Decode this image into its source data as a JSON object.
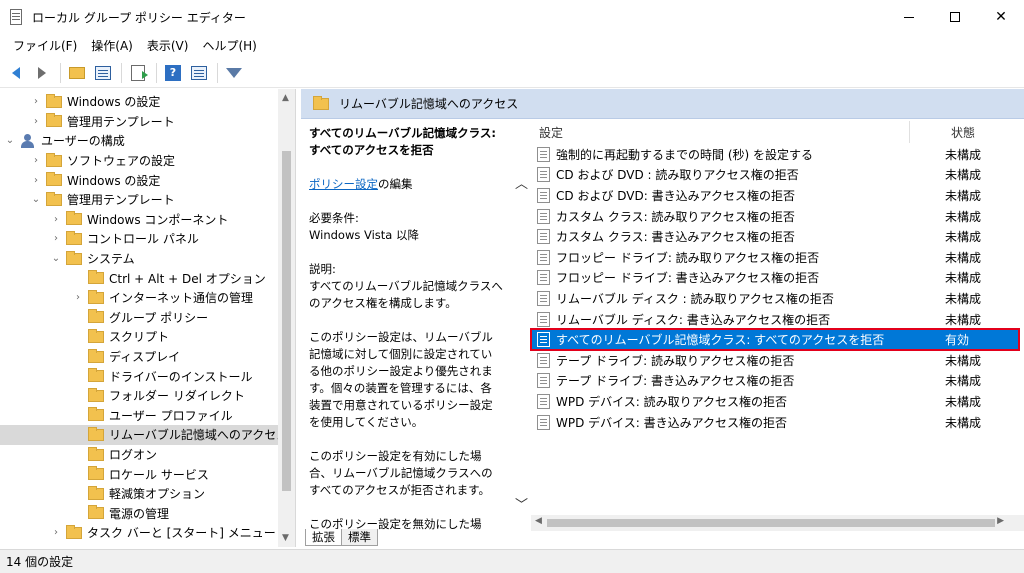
{
  "window": {
    "title": "ローカル グループ ポリシー エディター",
    "minimize_glyph": "",
    "maximize_glyph": "",
    "close_glyph": "✕"
  },
  "menu": [
    {
      "label": "ファイル(F)"
    },
    {
      "label": "操作(A)"
    },
    {
      "label": "表示(V)"
    },
    {
      "label": "ヘルプ(H)"
    }
  ],
  "toolbar": {
    "icons": [
      "back-icon",
      "forward-icon",
      "up-folder-icon",
      "show-hide-tree-icon",
      "export-list-icon",
      "help-icon",
      "properties-icon",
      "filter-icon"
    ],
    "help_glyph": "?"
  },
  "tree": {
    "items": [
      {
        "label": "Windows の設定",
        "level": 2,
        "expander": "›",
        "icon": "folder"
      },
      {
        "label": "管理用テンプレート",
        "level": 2,
        "expander": "›",
        "icon": "folder"
      },
      {
        "label": "ユーザーの構成",
        "level": 0,
        "expander": "⌄",
        "icon": "user"
      },
      {
        "label": "ソフトウェアの設定",
        "level": 2,
        "expander": "›",
        "icon": "folder"
      },
      {
        "label": "Windows の設定",
        "level": 2,
        "expander": "›",
        "icon": "folder"
      },
      {
        "label": "管理用テンプレート",
        "level": 2,
        "expander": "⌄",
        "icon": "folder"
      },
      {
        "label": "Windows コンポーネント",
        "level": 3,
        "expander": "›",
        "icon": "folder"
      },
      {
        "label": "コントロール パネル",
        "level": 3,
        "expander": "›",
        "icon": "folder"
      },
      {
        "label": "システム",
        "level": 3,
        "expander": "⌄",
        "icon": "folder"
      },
      {
        "label": "Ctrl + Alt + Del オプション",
        "level": 4,
        "expander": "",
        "icon": "folder"
      },
      {
        "label": "インターネット通信の管理",
        "level": 4,
        "expander": "›",
        "icon": "folder"
      },
      {
        "label": "グループ ポリシー",
        "level": 4,
        "expander": "",
        "icon": "folder"
      },
      {
        "label": "スクリプト",
        "level": 4,
        "expander": "",
        "icon": "folder"
      },
      {
        "label": "ディスプレイ",
        "level": 4,
        "expander": "",
        "icon": "folder"
      },
      {
        "label": "ドライバーのインストール",
        "level": 4,
        "expander": "",
        "icon": "folder"
      },
      {
        "label": "フォルダー リダイレクト",
        "level": 4,
        "expander": "",
        "icon": "folder"
      },
      {
        "label": "ユーザー プロファイル",
        "level": 4,
        "expander": "",
        "icon": "folder"
      },
      {
        "label": "リムーバブル記憶域へのアクセス",
        "level": 4,
        "expander": "",
        "icon": "folder",
        "selected": true
      },
      {
        "label": "ログオン",
        "level": 4,
        "expander": "",
        "icon": "folder"
      },
      {
        "label": "ロケール サービス",
        "level": 4,
        "expander": "",
        "icon": "folder"
      },
      {
        "label": "軽減策オプション",
        "level": 4,
        "expander": "",
        "icon": "folder"
      },
      {
        "label": "電源の管理",
        "level": 4,
        "expander": "",
        "icon": "folder"
      },
      {
        "label": "タスク バーと [スタート] メニュー",
        "level": 3,
        "expander": "›",
        "icon": "folder"
      }
    ]
  },
  "header": {
    "title": "リムーバブル記憶域へのアクセス"
  },
  "description": {
    "title": "すべてのリムーバブル記憶域クラス: すべてのアクセスを拒否",
    "edit_link": "ポリシー設定",
    "edit_suffix": "の編集",
    "req_label": "必要条件:",
    "req_value": "Windows Vista 以降",
    "desc_label": "説明:",
    "para1": "すべてのリムーバブル記憶域クラスへのアクセス権を構成します。",
    "para2": "このポリシー設定は、リムーバブル記憶域に対して個別に設定されている他のポリシー設定より優先されます。個々の装置を管理するには、各装置で用意されているポリシー設定を使用してください。",
    "para3": "このポリシー設定を有効にした場合、リムーバブル記憶域クラスへのすべてのアクセスが拒否されます。",
    "para4": "このポリシー設定を無効にした場合、またはい構成しない場合は、すべての リ"
  },
  "list": {
    "col_setting": "設定",
    "col_state": "状態",
    "rows": [
      {
        "name": "強制的に再起動するまでの時間 (秒) を設定する",
        "state": "未構成"
      },
      {
        "name": "CD および DVD : 読み取りアクセス権の拒否",
        "state": "未構成"
      },
      {
        "name": "CD および DVD: 書き込みアクセス権の拒否",
        "state": "未構成"
      },
      {
        "name": "カスタム クラス: 読み取りアクセス権の拒否",
        "state": "未構成"
      },
      {
        "name": "カスタム クラス: 書き込みアクセス権の拒否",
        "state": "未構成"
      },
      {
        "name": "フロッピー ドライブ: 読み取りアクセス権の拒否",
        "state": "未構成"
      },
      {
        "name": "フロッピー ドライブ: 書き込みアクセス権の拒否",
        "state": "未構成"
      },
      {
        "name": "リムーバブル ディスク : 読み取りアクセス権の拒否",
        "state": "未構成"
      },
      {
        "name": "リムーバブル ディスク: 書き込みアクセス権の拒否",
        "state": "未構成"
      },
      {
        "name": "すべてのリムーバブル記憶域クラス: すべてのアクセスを拒否",
        "state": "有効",
        "selected": true
      },
      {
        "name": "テープ ドライブ: 読み取りアクセス権の拒否",
        "state": "未構成"
      },
      {
        "name": "テープ ドライブ: 書き込みアクセス権の拒否",
        "state": "未構成"
      },
      {
        "name": "WPD デバイス: 読み取りアクセス権の拒否",
        "state": "未構成"
      },
      {
        "name": "WPD デバイス: 書き込みアクセス権の拒否",
        "state": "未構成"
      }
    ]
  },
  "tabs": [
    {
      "label": "拡張",
      "active": true
    },
    {
      "label": "標準",
      "active": false
    }
  ],
  "status": {
    "text": "14 個の設定"
  },
  "colors": {
    "selection": "#0078d7",
    "highlight_border": "#e3001b",
    "header_band": "#d1def0"
  }
}
